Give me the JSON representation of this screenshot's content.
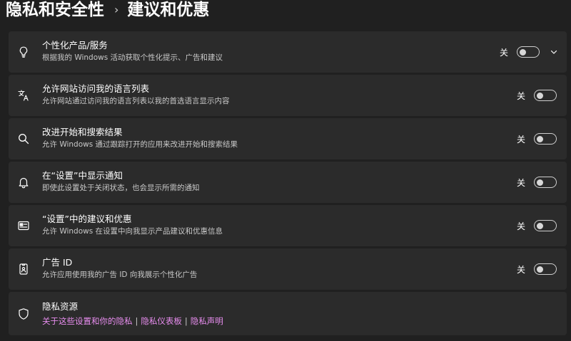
{
  "breadcrumb": {
    "parent": "隐私和安全性",
    "separator": "›",
    "current": "建议和优惠"
  },
  "settings": [
    {
      "title": "个性化产品/服务",
      "description": "根据我的 Windows 活动获取个性化提示、广告和建议",
      "state": "关",
      "icon": "lightbulb-icon",
      "expandable": true
    },
    {
      "title": "允许网站访问我的语言列表",
      "description": "允许网站通过访问我的语言列表以我的首选语言显示内容",
      "state": "关",
      "icon": "language-icon"
    },
    {
      "title": "改进开始和搜索结果",
      "description": "允许 Windows 通过跟踪打开的应用来改进开始和搜索结果",
      "state": "关",
      "icon": "search-icon"
    },
    {
      "title": "在“设置”中显示通知",
      "description": "即使此设置处于关闭状态，也会显示所需的通知",
      "state": "关",
      "icon": "bell-icon"
    },
    {
      "title": "“设置”中的建议和优惠",
      "description": "允许 Windows 在设置中向我显示产品建议和优惠信息",
      "state": "关",
      "icon": "settings-window-icon"
    },
    {
      "title": "广告 ID",
      "description": "允许应用使用我的广告 ID 向我展示个性化广告",
      "state": "关",
      "icon": "advertising-id-icon"
    }
  ],
  "privacy_resources": {
    "title": "隐私资源",
    "icon": "shield-icon",
    "links": [
      "关于这些设置和你的隐私",
      "隐私仪表板",
      "隐私声明"
    ],
    "separator": "|"
  },
  "colors": {
    "background": "#202020",
    "card": "#2b2b2b",
    "link": "#e98ef0"
  }
}
